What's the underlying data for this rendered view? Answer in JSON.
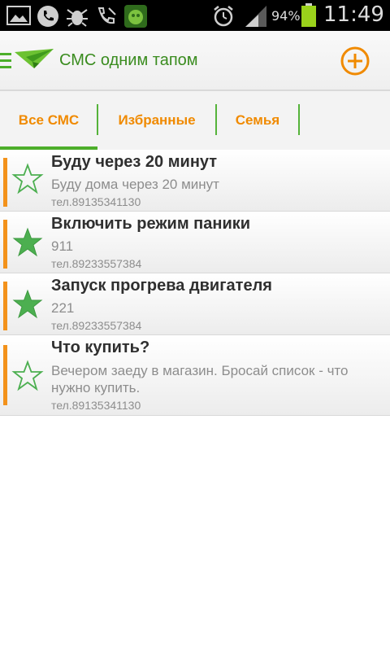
{
  "status_bar": {
    "battery": "94%",
    "time": "11:49"
  },
  "app_bar": {
    "title": "СМС одним тапом"
  },
  "tabs": [
    {
      "label": "Все СМС",
      "active": true
    },
    {
      "label": "Избранные",
      "active": false
    },
    {
      "label": "Семья",
      "active": false
    }
  ],
  "messages": [
    {
      "title": "Буду через 20 минут",
      "body": "Буду дома через 20 минут",
      "phone": "тел.89135341130",
      "favorite": false
    },
    {
      "title": "Включить режим паники",
      "body": "911",
      "phone": "тел.89233557384",
      "favorite": true
    },
    {
      "title": "Запуск прогрева двигателя",
      "body": "221",
      "phone": "тел.89233557384",
      "favorite": true
    },
    {
      "title": "Что купить?",
      "body": "Вечером заеду в магазин. Бросай список - что нужно купить.",
      "phone": "тел.89135341130",
      "favorite": false
    }
  ],
  "colors": {
    "accent_orange": "#f08a00",
    "accent_green": "#4caf2a",
    "star_green": "#4caf50"
  }
}
